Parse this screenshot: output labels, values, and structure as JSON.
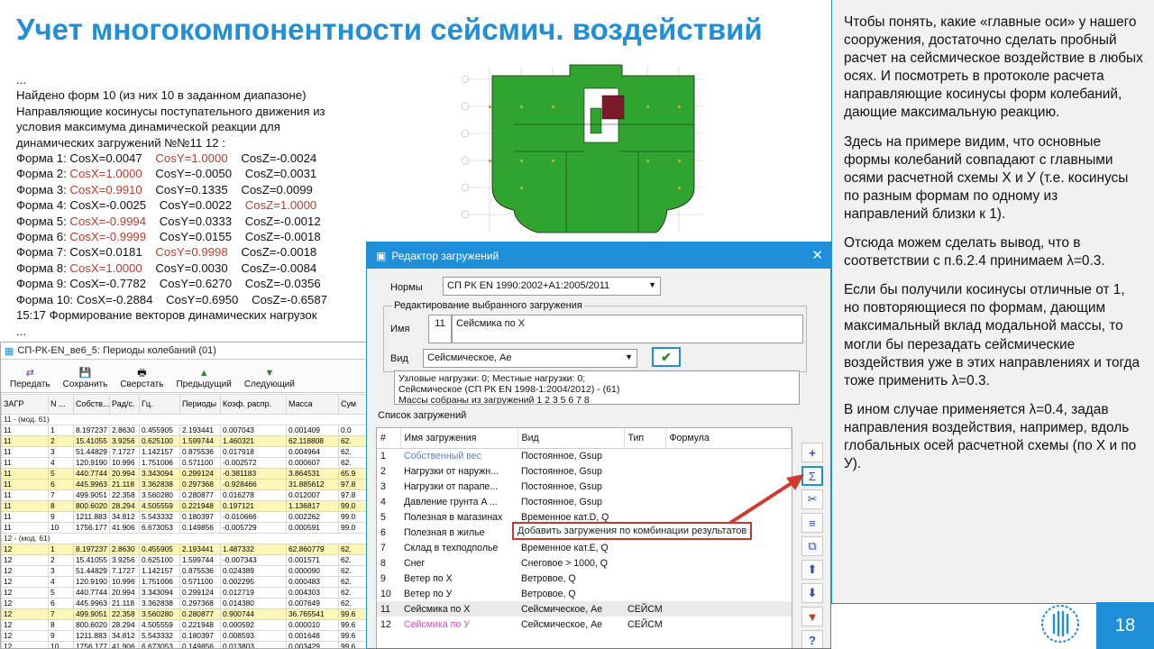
{
  "title": "Учет многокомпонентности сейсмич. воздействий",
  "protocol": {
    "lines": [
      "...",
      "Найдено форм 10 (из них 10 в заданном диапазоне)",
      "Направляющие косинусы поступательного движения из",
      "условия максимума динамической реакции для",
      "динамических загружений №№11 12 :"
    ],
    "forms": [
      {
        "label": "Форма 1:",
        "x": "CosX=0.0047",
        "y": "CosY=1.0000",
        "z": "CosZ=-0.0024",
        "hi": "y"
      },
      {
        "label": "Форма 2:",
        "x": "CosX=1.0000",
        "y": "CosY=-0.0050",
        "z": "CosZ=0.0031",
        "hi": "x"
      },
      {
        "label": "Форма 3:",
        "x": "CosX=0.9910",
        "y": "CosY=0.1335",
        "z": "CosZ=0.0099",
        "hi": "x"
      },
      {
        "label": "Форма 4:",
        "x": "CosX=-0.0025",
        "y": "CosY=0.0022",
        "z": "CosZ=1.0000",
        "hi": "z"
      },
      {
        "label": "Форма 5:",
        "x": "CosX=-0.9994",
        "y": "CosY=0.0333",
        "z": "CosZ=-0.0012",
        "hi": "x"
      },
      {
        "label": "Форма 6:",
        "x": "CosX=-0.9999",
        "y": "CosY=0.0155",
        "z": "CosZ=-0.0018",
        "hi": "x"
      },
      {
        "label": "Форма 7:",
        "x": "CosX=0.0181",
        "y": "CosY=0.9998",
        "z": "CosZ=-0.0018",
        "hi": "y"
      },
      {
        "label": "Форма 8:",
        "x": "CosX=1.0000",
        "y": "CosY=0.0030",
        "z": "CosZ=-0.0084",
        "hi": "x"
      },
      {
        "label": "Форма 9:",
        "x": "CosX=-0.7782",
        "y": "CosY=0.6270",
        "z": "CosZ=-0.0356",
        "hi": ""
      },
      {
        "label": "Форма 10:",
        "x": "CosX=-0.2884",
        "y": "CosY=0.6950",
        "z": "CosZ=-0.6587",
        "hi": ""
      }
    ],
    "tail": [
      "15:17  Формирование векторов динамических нагрузок",
      "..."
    ]
  },
  "right_panel": {
    "p1": "Чтобы понять, какие «главные оси» у нашего сооружения, достаточно сделать пробный расчет на сейсмическое воздействие в любых осях. И посмотреть в протоколе расчета направляющие косинусы форм колебаний, дающие максимальную реакцию.",
    "p2": "Здесь на примере видим, что основные формы колебаний совпадают с главными осями расчетной схемы X и У (т.е. косинусы по разным формам по одному из направлений близки к 1).",
    "p3": "Отсюда можем сделать вывод, что в соответствии с п.6.2.4 принимаем λ=0.3.",
    "p4": "Если бы получили косинусы отличные от 1, но повторяющиеся по формам, дающим максимальный вклад модальной массы, то могли бы перезадать сейсмические воздействия уже в этих направлениях и тогда тоже применить λ=0.3.",
    "p5": "В ином случае применяется λ=0.4, задав направления воздействия, например, вдоль глобальных осей расчетной схемы (по X и по У)."
  },
  "page_number": "18",
  "periods_window": {
    "title": "СП-РК-EN_ве6_5: Периоды колебаний (01)",
    "toolbar": [
      "Передать",
      "Сохранить",
      "Сверстать",
      "Предыдущий",
      "Следующий"
    ],
    "headers": [
      "ЗАГР",
      "N ...",
      "Собств...",
      "Рад/с.",
      "Гц.",
      "Периоды",
      "Коэф. распр.",
      "Масса",
      "Сум"
    ],
    "groups": [
      {
        "label": "11 - (мод. 61)",
        "rows": [
          [
            "11",
            "1",
            "8.197237",
            "2.8630",
            "0.455905",
            "2.193441",
            "0.007043",
            "0.001409",
            "0.0",
            false
          ],
          [
            "11",
            "2",
            "15.41055",
            "3.9256",
            "0.625100",
            "1.599744",
            "1.460321",
            "62.118808",
            "62.",
            true
          ],
          [
            "11",
            "3",
            "51.44829",
            "7.1727",
            "1.142157",
            "0.875536",
            "0.017918",
            "0.004964",
            "62.",
            false
          ],
          [
            "11",
            "4",
            "120.9190",
            "10.996",
            "1.751006",
            "0.571100",
            "-0.002572",
            "0.000607",
            "62.",
            false
          ],
          [
            "11",
            "5",
            "440.7744",
            "20.994",
            "3.343094",
            "0.299124",
            "-0.381183",
            "3.864531",
            "65.9",
            true
          ],
          [
            "11",
            "6",
            "445.9963",
            "21.118",
            "3.362838",
            "0.297368",
            "-0.928466",
            "31.885612",
            "97.8",
            true
          ],
          [
            "11",
            "7",
            "499.9051",
            "22.358",
            "3.560280",
            "0.280877",
            "0.016278",
            "0.012007",
            "97.8",
            false
          ],
          [
            "11",
            "8",
            "800.6020",
            "28.294",
            "4.505559",
            "0.221948",
            "0.197121",
            "1.136817",
            "99.0",
            true
          ],
          [
            "11",
            "9",
            "1211.883",
            "34.812",
            "5.543332",
            "0.180397",
            "-0.010666",
            "0.002262",
            "99.0",
            false
          ],
          [
            "11",
            "10",
            "1756.177",
            "41.906",
            "6.673053",
            "0.149856",
            "-0.005729",
            "0.000591",
            "99.0",
            false
          ]
        ]
      },
      {
        "label": "12 - (мод. 61)",
        "rows": [
          [
            "12",
            "1",
            "8.197237",
            "2.8630",
            "0.455905",
            "2.193441",
            "1.487332",
            "62.860779",
            "62.",
            true
          ],
          [
            "12",
            "2",
            "15.41055",
            "3.9256",
            "0.625100",
            "1.599744",
            "-0.007343",
            "0.001571",
            "62.",
            false
          ],
          [
            "12",
            "3",
            "51.44829",
            "7.1727",
            "1.142157",
            "0.875536",
            "0.024389",
            "0.000090",
            "62.",
            false
          ],
          [
            "12",
            "4",
            "120.9190",
            "10.996",
            "1.751006",
            "0.571100",
            "0.002295",
            "0.000483",
            "62.",
            false
          ],
          [
            "12",
            "5",
            "440.7744",
            "20.994",
            "3.343094",
            "0.299124",
            "0.012719",
            "0.004303",
            "62.",
            false
          ],
          [
            "12",
            "6",
            "445.9963",
            "21.118",
            "3.362838",
            "0.297368",
            "0.014380",
            "0.007649",
            "62.",
            false
          ],
          [
            "12",
            "7",
            "499.9051",
            "22.358",
            "3.560280",
            "0.280877",
            "0.900744",
            "36.765541",
            "99.6",
            true
          ],
          [
            "12",
            "8",
            "800.6020",
            "28.294",
            "4.505559",
            "0.221948",
            "0.000592",
            "0.000010",
            "99.6",
            false
          ],
          [
            "12",
            "9",
            "1211.883",
            "34.812",
            "5.543332",
            "0.180397",
            "0.008593",
            "0.001648",
            "99.6",
            false
          ],
          [
            "12",
            "10",
            "1756.177",
            "41.906",
            "6.673053",
            "0.149856",
            "0.013803",
            "0.003429",
            "99.6",
            false
          ]
        ]
      }
    ]
  },
  "load_editor": {
    "title": "Редактор загружений",
    "norms_label": "Нормы",
    "norms_value": "СП РК EN 1990:2002+A1:2005/2011",
    "group_label": "Редактирование выбранного загружения",
    "name_label": "Имя",
    "name_num": "11",
    "name_value": "Сейсмика по X",
    "type_label": "Вид",
    "type_value": "Сейсмическое, Ae",
    "info_lines": [
      "Узловые нагрузки:  0;  Местные нагрузки:  0;",
      "Сейсмическое (СП РК EN 1998-1:2004/2012) - (61)",
      "Массы собраны из загружений   1 2 3 5 6 7 8"
    ],
    "list_label": "Список загружений",
    "list_headers": [
      "#",
      "Имя загружения",
      "Вид",
      "Тип",
      "Формула"
    ],
    "loads": [
      {
        "n": "1",
        "name": "Собственный вес",
        "kind": "Постоянное, Gsup",
        "type": "",
        "formula": "",
        "color": "#5a7fd6"
      },
      {
        "n": "2",
        "name": "Нагрузки от наружн...",
        "kind": "Постоянное, Gsup",
        "type": "",
        "formula": "",
        "color": "#111111"
      },
      {
        "n": "3",
        "name": "Нагрузки от парапе...",
        "kind": "Постоянное, Gsup",
        "type": "",
        "formula": "",
        "color": "#111111"
      },
      {
        "n": "4",
        "name": "Давление грунта A ...",
        "kind": "Постоянное, Gsup",
        "type": "",
        "formula": "",
        "color": "#111111"
      },
      {
        "n": "5",
        "name": "Полезная в магазинах",
        "kind": "Временное кат.D, Q",
        "type": "",
        "formula": "",
        "color": "#111111"
      },
      {
        "n": "6",
        "name": "Полезная в жилье",
        "kind": "",
        "type": "",
        "formula": "",
        "color": "#111111"
      },
      {
        "n": "7",
        "name": "Склад в техподполье",
        "kind": "Временное кат.E, Q",
        "type": "",
        "formula": "",
        "color": "#111111"
      },
      {
        "n": "8",
        "name": "Снег",
        "kind": "Снеговое > 1000, Q",
        "type": "",
        "formula": "",
        "color": "#111111"
      },
      {
        "n": "9",
        "name": "Ветер по X",
        "kind": "Ветровое, Q",
        "type": "",
        "formula": "",
        "color": "#111111"
      },
      {
        "n": "10",
        "name": "Ветер по У",
        "kind": "Ветровое, Q",
        "type": "",
        "formula": "",
        "color": "#111111"
      },
      {
        "n": "11",
        "name": "Сейсмика по X",
        "kind": "Сейсмическое, Ae",
        "type": "СЕЙСМ",
        "formula": "",
        "color": "#111111"
      },
      {
        "n": "12",
        "name": "Сейсмика по У",
        "kind": "Сейсмическое, Ae",
        "type": "СЕЙСМ",
        "formula": "",
        "color": "#d24bb4"
      }
    ],
    "tooltip": "Добавить загружения по комбинации результатов"
  }
}
